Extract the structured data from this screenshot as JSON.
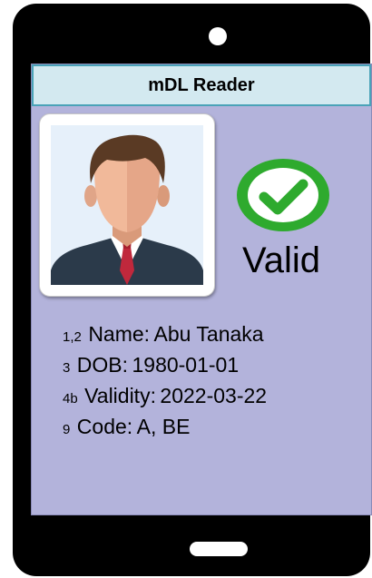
{
  "app": {
    "title": "mDL Reader"
  },
  "verification": {
    "status": "Valid",
    "status_icon": "check-circle-icon",
    "status_color": "#2eaa2e"
  },
  "fields": [
    {
      "num": "1,2",
      "label": "Name:",
      "value": "Abu Tanaka"
    },
    {
      "num": "3",
      "label": "DOB:",
      "value": "1980-01-01"
    },
    {
      "num": "4b",
      "label": "Validity:",
      "value": "2022-03-22"
    },
    {
      "num": "9",
      "label": "Code:",
      "value": "A, BE"
    }
  ],
  "colors": {
    "device": "#000000",
    "screen_bg": "#b3b3db",
    "title_bar_bg": "#d3e9f0",
    "title_bar_border": "#4aa3b8"
  }
}
